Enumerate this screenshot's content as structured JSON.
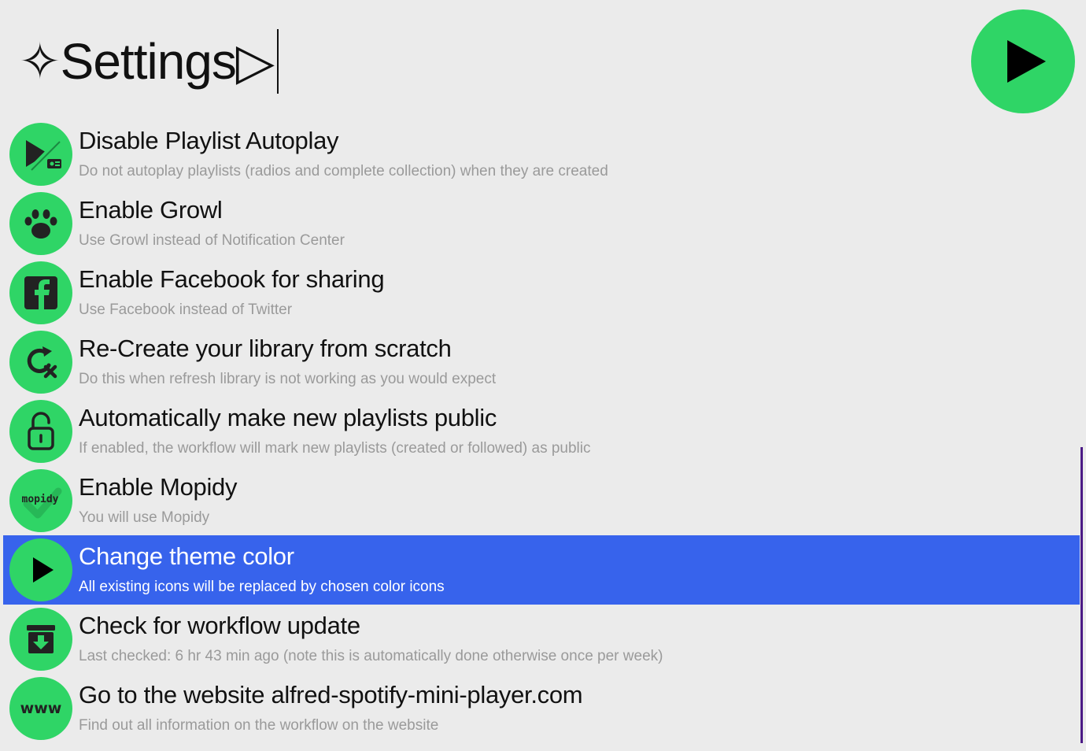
{
  "search": {
    "query": "✧Settings▷",
    "theme_color": "#2fd566",
    "selection_color": "#3763ec"
  },
  "app_logo": {
    "icon": "play-icon"
  },
  "results": [
    {
      "icon": "play-muted-radio-icon",
      "title": "Disable Playlist Autoplay",
      "subtitle": "Do not autoplay playlists (radios and complete collection) when they are created"
    },
    {
      "icon": "paw-icon",
      "title": "Enable Growl",
      "subtitle": "Use Growl instead of Notification Center"
    },
    {
      "icon": "facebook-icon",
      "title": "Enable Facebook for sharing",
      "subtitle": "Use Facebook instead of Twitter"
    },
    {
      "icon": "refresh-x-icon",
      "title": "Re-Create your library from scratch",
      "subtitle": "Do this when refresh library is not working as you would expect"
    },
    {
      "icon": "unlock-icon",
      "title": "Automatically make new playlists public",
      "subtitle": "If enabled, the workflow will mark new playlists (created or followed) as public"
    },
    {
      "icon": "mopidy-icon",
      "icon_text": "mopidy",
      "title": "Enable Mopidy",
      "subtitle": "You will use Mopidy"
    },
    {
      "icon": "play-icon",
      "title": "Change theme color",
      "subtitle": "All existing icons will be replaced by chosen color icons",
      "selected": true
    },
    {
      "icon": "archive-download-icon",
      "title": "Check for workflow update",
      "subtitle": "Last checked: 6 hr 43 min ago (note this is automatically done otherwise once per week)"
    },
    {
      "icon": "www-icon",
      "icon_text": "www",
      "title": "Go to the website alfred-spotify-mini-player.com",
      "subtitle": "Find out all information on the workflow on the website"
    }
  ]
}
